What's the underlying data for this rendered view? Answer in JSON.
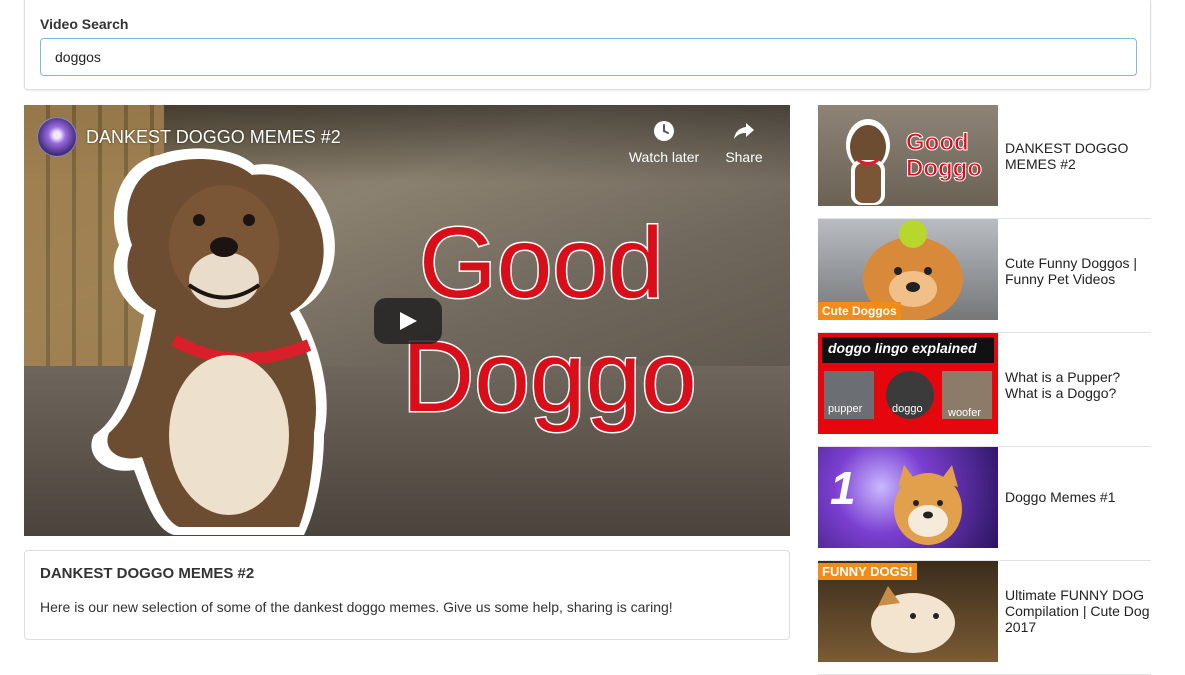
{
  "search": {
    "label": "Video Search",
    "value": "doggos"
  },
  "player": {
    "title": "DANKEST DOGGO MEMES #2",
    "overlay_line1": "Good",
    "overlay_line2": "Doggo",
    "watch_later_label": "Watch later",
    "share_label": "Share"
  },
  "selected_video": {
    "title": "DANKEST DOGGO MEMES #2",
    "description": "Here is our new selection of some of the dankest doggo memes. Give us some help, sharing is caring!"
  },
  "video_list": {
    "items": [
      {
        "title": "DANKEST DOGGO MEMES #2",
        "thumb_text_1": "Good",
        "thumb_text_2": "Doggo"
      },
      {
        "title": "Cute Funny Doggos | Funny Pet Videos",
        "thumb_badge": "Cute Doggos"
      },
      {
        "title": "What is a Pupper? What is a Doggo?",
        "thumb_header": "doggo lingo explained",
        "thumb_labels": [
          "pupper",
          "doggo",
          "woofer"
        ]
      },
      {
        "title": "Doggo Memes #1",
        "thumb_number": "1"
      },
      {
        "title": "Ultimate FUNNY DOG Compilation | Cute Dog 2017",
        "thumb_badge": "FUNNY DOGS!"
      }
    ]
  },
  "colors": {
    "accent_red": "#d80f1b",
    "input_border": "#85b7d9"
  }
}
